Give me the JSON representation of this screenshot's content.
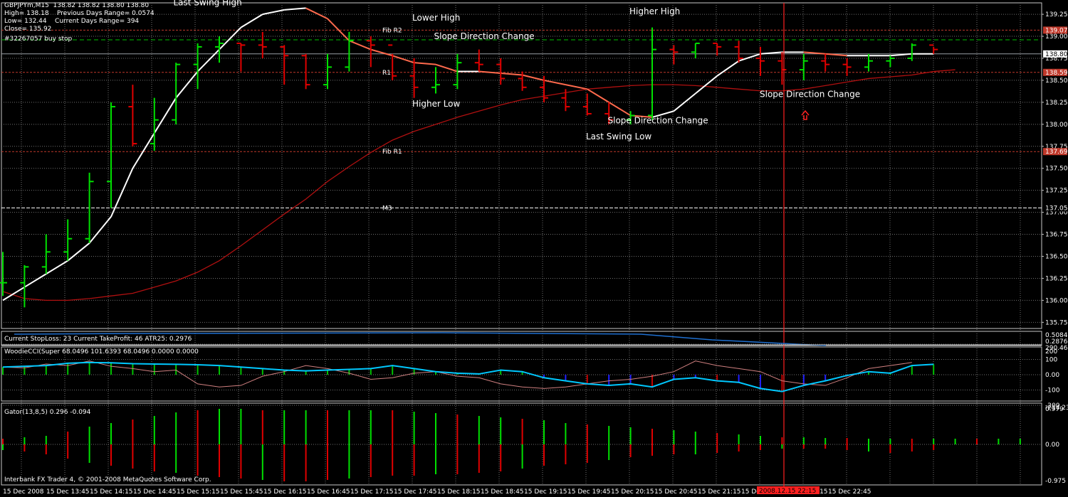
{
  "info": {
    "symbol_line": "GBPJPYm,M15  138.82 138.82 138.80 138.80",
    "high_line": "High= 138.18    Previous Days Range= 0.0574",
    "low_line": "Low= 132.44    Current Days Range= 394",
    "close_line": "Close= 135.92",
    "order_line": "#32267057 buy stop"
  },
  "footer": "Interbank FX Trader 4, © 2001-2008 MetaQuotes Software Corp.",
  "annotations": [
    {
      "text": "Last Swing High",
      "x": "15 Dec 15:00",
      "y": 139.35
    },
    {
      "text": "Lower High",
      "x": "15 Dec 17:45",
      "y": 139.18
    },
    {
      "text": "Slope Direction Change",
      "x": "15 Dec 18:00",
      "y": 138.97
    },
    {
      "text": "Higher High",
      "x": "15 Dec 20:15",
      "y": 139.25
    },
    {
      "text": "Higher Low",
      "x": "15 Dec 17:45",
      "y": 138.2
    },
    {
      "text": "Slope Direction Change",
      "x": "15 Dec 20:00",
      "y": 138.01
    },
    {
      "text": "Last Swing Low",
      "x": "15 Dec 19:45",
      "y": 137.83
    },
    {
      "text": "Slope Direction Change",
      "x": "15 Dec 21:45",
      "y": 138.31
    }
  ],
  "level_lines": [
    {
      "label": "Fib R2",
      "value": 139.07,
      "color": "#c0392b",
      "tag": "139.07"
    },
    {
      "label": "R1",
      "value": 138.59,
      "color": "#c0392b",
      "tag": "138.59"
    },
    {
      "label": "Fib R1",
      "value": 137.69,
      "color": "#c0392b",
      "tag": "137.69"
    },
    {
      "label": "M3",
      "value": 137.05,
      "color": "#ffffff",
      "tag": "137.05"
    }
  ],
  "current_price_tag": "138.80",
  "price_axis_ticks": [
    "139.25",
    "139.00",
    "138.75",
    "138.50",
    "138.25",
    "138.00",
    "137.75",
    "137.50",
    "137.25",
    "137.00",
    "136.75",
    "136.50",
    "136.25",
    "136.00",
    "135.75"
  ],
  "time_labels": [
    "15 Dec 2008",
    "15 Dec 13:45",
    "15 Dec 14:15",
    "15 Dec 14:45",
    "15 Dec 15:15",
    "15 Dec 15:45",
    "15 Dec 16:15",
    "15 Dec 16:45",
    "15 Dec 17:15",
    "15 Dec 17:45",
    "15 Dec 18:15",
    "15 Dec 18:45",
    "15 Dec 19:15",
    "15 Dec 19:45",
    "15 Dec 20:15",
    "15 Dec 20:45",
    "15 Dec 21:15",
    "15 Dec 21:45",
    "15 Dec 22:15",
    "15 Dec 22:45"
  ],
  "cursor_time_label": "2008.12.15 22:15",
  "panel1": {
    "label": "Current StopLoss: 23  Current TakeProfit: 46  ATR25:  0.2976",
    "ticks": [
      "0.5084",
      "0.2876"
    ]
  },
  "panel2": {
    "label": "WoodieCCI(Super 68.0496 101.6393 68.0496 0.0000 0.0000",
    "ticks": [
      "290.4659",
      "200",
      "100",
      "0.00",
      "-100",
      "-200",
      "-214.2388"
    ]
  },
  "panel3": {
    "label": "Gator(13,8,5) 0.296 -0.094",
    "ticks": [
      "0.979",
      "0.00",
      "-0.975"
    ]
  },
  "colors": {
    "up_bar": "#00e000",
    "down_bar": "#e00000",
    "fast_ma_up": "#ffffff",
    "fast_ma_down": "#ff6a4d",
    "slow_ma": "#b01010",
    "grid": "#6f6f6f",
    "cursor": "#ff2020",
    "cci_main": "#00c8ff",
    "atr": "#1e6fd0"
  },
  "chart_data": {
    "type": "line",
    "title": "GBPJPYm,M15",
    "x_label_pattern": "15 Dec HH:MM (15-minute bars)",
    "ylim": [
      135.75,
      139.25
    ],
    "ohlc_approx": [
      {
        "t": 0,
        "open": 136.2,
        "close": 136.2,
        "high": 136.55,
        "low": 136.05
      },
      {
        "t": 1,
        "open": 136.2,
        "close": 136.38,
        "high": 136.4,
        "low": 135.92
      },
      {
        "t": 2,
        "open": 136.38,
        "close": 136.55,
        "high": 136.75,
        "low": 136.3
      },
      {
        "t": 3,
        "open": 136.55,
        "close": 136.7,
        "high": 136.92,
        "low": 136.45
      },
      {
        "t": 4,
        "open": 136.7,
        "close": 137.35,
        "high": 137.45,
        "low": 136.65
      },
      {
        "t": 5,
        "open": 137.35,
        "close": 138.2,
        "high": 138.25,
        "low": 137.05
      },
      {
        "t": 6,
        "open": 138.2,
        "close": 137.78,
        "high": 138.45,
        "low": 137.75
      },
      {
        "t": 7,
        "open": 137.78,
        "close": 138.05,
        "high": 138.3,
        "low": 137.7
      },
      {
        "t": 8,
        "open": 138.05,
        "close": 138.68,
        "high": 138.7,
        "low": 138.0
      },
      {
        "t": 9,
        "open": 138.68,
        "close": 138.88,
        "high": 138.92,
        "low": 138.4
      },
      {
        "t": 10,
        "open": 138.88,
        "close": 138.92,
        "high": 139.0,
        "low": 138.7
      },
      {
        "t": 11,
        "open": 138.92,
        "close": 138.9,
        "high": 138.92,
        "low": 138.6
      },
      {
        "t": 12,
        "open": 138.9,
        "close": 138.88,
        "high": 139.05,
        "low": 138.75
      },
      {
        "t": 13,
        "open": 138.88,
        "close": 138.78,
        "high": 138.9,
        "low": 138.45
      },
      {
        "t": 14,
        "open": 138.78,
        "close": 138.45,
        "high": 138.8,
        "low": 138.4
      },
      {
        "t": 15,
        "open": 138.45,
        "close": 138.65,
        "high": 138.8,
        "low": 138.4
      },
      {
        "t": 16,
        "open": 138.65,
        "close": 138.95,
        "high": 139.05,
        "low": 138.6
      },
      {
        "t": 17,
        "open": 138.95,
        "close": 138.9,
        "high": 139.0,
        "low": 138.65
      },
      {
        "t": 18,
        "open": 138.9,
        "close": 138.55,
        "high": 138.8,
        "low": 138.5
      },
      {
        "t": 19,
        "open": 138.55,
        "close": 138.42,
        "high": 138.75,
        "low": 138.3
      },
      {
        "t": 20,
        "open": 138.42,
        "close": 138.45,
        "high": 138.65,
        "low": 138.35
      },
      {
        "t": 21,
        "open": 138.45,
        "close": 138.7,
        "high": 138.8,
        "low": 138.4
      },
      {
        "t": 22,
        "open": 138.7,
        "close": 138.68,
        "high": 138.85,
        "low": 138.6
      },
      {
        "t": 23,
        "open": 138.68,
        "close": 138.52,
        "high": 138.75,
        "low": 138.45
      },
      {
        "t": 24,
        "open": 138.52,
        "close": 138.42,
        "high": 138.6,
        "low": 138.38
      },
      {
        "t": 25,
        "open": 138.42,
        "close": 138.3,
        "high": 138.55,
        "low": 138.25
      },
      {
        "t": 26,
        "open": 138.3,
        "close": 138.2,
        "high": 138.4,
        "low": 138.15
      },
      {
        "t": 27,
        "open": 138.2,
        "close": 138.12,
        "high": 138.35,
        "low": 138.1
      },
      {
        "t": 28,
        "open": 138.12,
        "close": 138.05,
        "high": 138.25,
        "low": 138.0
      },
      {
        "t": 29,
        "open": 138.05,
        "close": 138.1,
        "high": 138.15,
        "low": 138.0
      },
      {
        "t": 30,
        "open": 138.1,
        "close": 138.85,
        "high": 139.1,
        "low": 138.05
      },
      {
        "t": 31,
        "open": 138.85,
        "close": 138.82,
        "high": 138.9,
        "low": 138.68
      },
      {
        "t": 32,
        "open": 138.82,
        "close": 138.92,
        "high": 138.92,
        "low": 138.75
      },
      {
        "t": 33,
        "open": 138.92,
        "close": 138.88,
        "high": 138.92,
        "low": 138.78
      },
      {
        "t": 34,
        "open": 138.88,
        "close": 138.75,
        "high": 138.95,
        "low": 138.7
      },
      {
        "t": 35,
        "open": 138.75,
        "close": 138.72,
        "high": 138.88,
        "low": 138.55
      },
      {
        "t": 36,
        "open": 138.72,
        "close": 138.62,
        "high": 138.82,
        "low": 138.45
      },
      {
        "t": 37,
        "open": 138.62,
        "close": 138.72,
        "high": 138.8,
        "low": 138.5
      },
      {
        "t": 38,
        "open": 138.72,
        "close": 138.68,
        "high": 138.8,
        "low": 138.6
      },
      {
        "t": 39,
        "open": 138.68,
        "close": 138.65,
        "high": 138.75,
        "low": 138.55
      },
      {
        "t": 40,
        "open": 138.65,
        "close": 138.72,
        "high": 138.8,
        "low": 138.6
      },
      {
        "t": 41,
        "open": 138.72,
        "close": 138.75,
        "high": 138.78,
        "low": 138.65
      },
      {
        "t": 42,
        "open": 138.75,
        "close": 138.9,
        "high": 138.92,
        "low": 138.72
      },
      {
        "t": 43,
        "open": 138.9,
        "close": 138.85,
        "high": 138.88,
        "low": 138.8
      }
    ],
    "series": [
      {
        "name": "fast_ma",
        "values": [
          136.0,
          136.15,
          136.3,
          136.45,
          136.65,
          136.95,
          137.5,
          137.9,
          138.3,
          138.6,
          138.85,
          139.1,
          139.25,
          139.3,
          139.32,
          139.2,
          138.95,
          138.85,
          138.78,
          138.7,
          138.68,
          138.6,
          138.6,
          138.58,
          138.56,
          138.5,
          138.45,
          138.4,
          138.25,
          138.1,
          138.08,
          138.15,
          138.35,
          138.55,
          138.72,
          138.8,
          138.82,
          138.82,
          138.8,
          138.78,
          138.78,
          138.78,
          138.8,
          138.8
        ]
      },
      {
        "name": "slow_ma",
        "values": [
          136.1,
          136.02,
          136.0,
          136.0,
          136.02,
          136.05,
          136.08,
          136.15,
          136.22,
          136.32,
          136.45,
          136.62,
          136.8,
          136.98,
          137.15,
          137.35,
          137.52,
          137.68,
          137.82,
          137.92,
          138.0,
          138.08,
          138.15,
          138.22,
          138.28,
          138.32,
          138.36,
          138.4,
          138.42,
          138.44,
          138.45,
          138.45,
          138.44,
          138.42,
          138.4,
          138.38,
          138.38,
          138.4,
          138.44,
          138.48,
          138.52,
          138.54,
          138.56,
          138.6,
          138.62
        ]
      }
    ]
  }
}
